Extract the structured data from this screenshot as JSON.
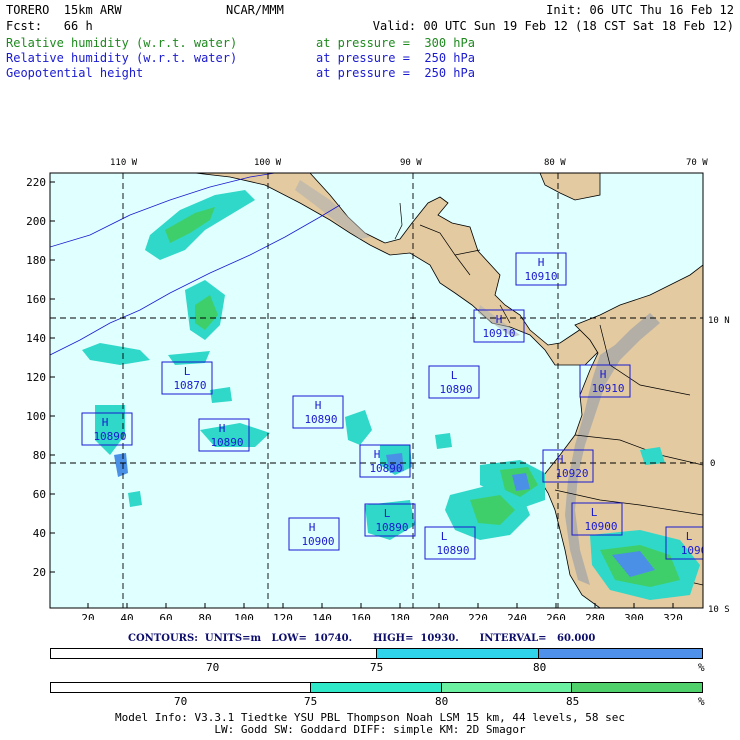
{
  "header": {
    "model": "TORERO  15km ARW",
    "org": "NCAR/MMM",
    "init": "Init: 06 UTC Thu 16 Feb 12",
    "fcst": "Fcst:   66 h",
    "valid": "Valid: 00 UTC Sun 19 Feb 12 (18 CST Sat 18 Feb 12)",
    "fields": [
      {
        "name": "Relative humidity (w.r.t. water)",
        "level": "at pressure =  300 hPa",
        "color": "#1e8a1e"
      },
      {
        "name": "Relative humidity (w.r.t. water)",
        "level": "at pressure =  250 hPa",
        "color": "#1a1ad0"
      },
      {
        "name": "Geopotential height",
        "level": "at pressure =  250 hPa",
        "color": "#000000"
      }
    ]
  },
  "map": {
    "lon_labels": [
      "110 W",
      "100 W",
      "90 W",
      "80 W",
      "70 W"
    ],
    "lat_labels": [
      "10 N",
      "0",
      "10 S"
    ],
    "y_ticks": [
      "220",
      "200",
      "180",
      "160",
      "140",
      "120",
      "100",
      "80",
      "60",
      "40",
      "20"
    ],
    "x_ticks": [
      "20",
      "40",
      "60",
      "80",
      "100",
      "120",
      "140",
      "160",
      "180",
      "200",
      "220",
      "240",
      "260",
      "280",
      "300",
      "320"
    ],
    "centers": [
      {
        "type": "H",
        "value": "10910"
      },
      {
        "type": "H",
        "value": "10910"
      },
      {
        "type": "L",
        "value": "10870"
      },
      {
        "type": "L",
        "value": "10890"
      },
      {
        "type": "H",
        "value": "10910"
      },
      {
        "type": "H",
        "value": "10890"
      },
      {
        "type": "H",
        "value": "10890"
      },
      {
        "type": "H",
        "value": "10890"
      },
      {
        "type": "H",
        "value": "10890"
      },
      {
        "type": "H",
        "value": "10920"
      },
      {
        "type": "L",
        "value": "10890"
      },
      {
        "type": "L",
        "value": "10900"
      },
      {
        "type": "H",
        "value": "10900"
      },
      {
        "type": "L",
        "value": "10890"
      },
      {
        "type": "L",
        "value": "1090"
      }
    ],
    "colors": {
      "ocean": "#e0ffff",
      "land": "#e3caa0",
      "terrain": "#9a9a9a",
      "rh_green": "#3fcf6a",
      "rh_cyan": "#2fd8c8",
      "rh_blue": "#4a90e6",
      "grid": "#000000"
    }
  },
  "contours": {
    "text": "CONTOURS:  UNITS=m   LOW=  10740.      HIGH=  10930.      INTERVAL=   60.000"
  },
  "colorbar_blue": {
    "ticks": [
      "70",
      "75",
      "80",
      "%"
    ],
    "segments": [
      {
        "color": "#ffffff",
        "frac": 0.5
      },
      {
        "color": "#2fd4ea",
        "frac": 0.25
      },
      {
        "color": "#4f90ea",
        "frac": 0.25
      }
    ]
  },
  "colorbar_green": {
    "ticks": [
      "70",
      "75",
      "80",
      "85",
      "%"
    ],
    "segments": [
      {
        "color": "#ffffff",
        "frac": 0.4
      },
      {
        "color": "#2fe8c8",
        "frac": 0.2
      },
      {
        "color": "#6af0a0",
        "frac": 0.2
      },
      {
        "color": "#4fd06a",
        "frac": 0.2
      }
    ]
  },
  "footer": {
    "line1": "Model Info: V3.3.1   Tiedtke YSU PBL  Thompson    Noah LSM  15 km,   44 levels,   58 sec",
    "line2": "LW: Godd SW: Goddard DIFF: simple KM: 2D Smagor"
  }
}
